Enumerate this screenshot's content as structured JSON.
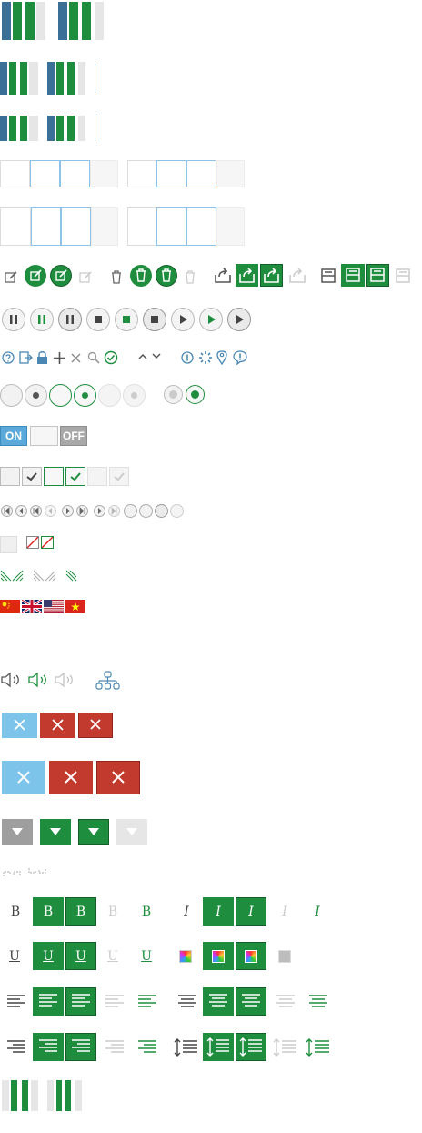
{
  "colors": {
    "accent_green": "#1e8e3e",
    "steel_blue": "#3a6f98",
    "light_blue": "#7cc4ea",
    "red": "#c23a2e",
    "gray": "#9e9e9e",
    "light_gray": "#e6e6e6"
  },
  "toggle": {
    "on_label": "ON",
    "off_label": "OFF"
  },
  "format": {
    "bold_glyph": "B",
    "italic_glyph": "I",
    "underline_glyph": "U"
  },
  "icon_row": [
    "edit-icon",
    "delete-icon",
    "export-icon",
    "save-icon"
  ],
  "media_row": [
    "pause-icon",
    "stop-icon",
    "play-icon"
  ],
  "misc_icons": [
    "help-icon",
    "logout-icon",
    "lock-icon",
    "plus-icon",
    "close-icon",
    "search-icon",
    "check-icon",
    "chevron-up-icon",
    "chevron-down-icon",
    "info-icon",
    "spinner-icon",
    "location-icon",
    "alert-icon"
  ],
  "flags": [
    "china-flag",
    "uk-flag",
    "usa-flag",
    "vietnam-flag"
  ]
}
